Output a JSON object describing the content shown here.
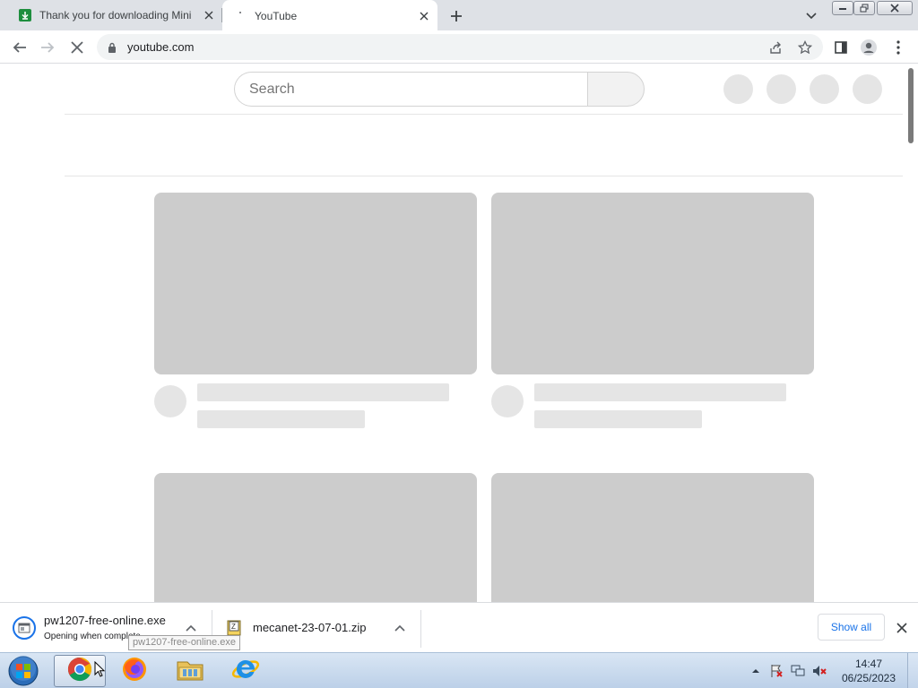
{
  "browser": {
    "tabs": [
      {
        "title": "Thank you for downloading Mini",
        "active": false
      },
      {
        "title": "YouTube",
        "active": true
      }
    ],
    "address": "youtube.com"
  },
  "youtube": {
    "search_placeholder": "Search"
  },
  "download_shelf": {
    "items": [
      {
        "filename": "pw1207-free-online.exe",
        "status": "Opening when complete"
      },
      {
        "filename": "mecanet-23-07-01.zip",
        "status": ""
      }
    ],
    "tooltip": "pw1207-free-online.exe",
    "show_all_label": "Show all"
  },
  "taskbar": {
    "time": "14:47",
    "date": "06/25/2023",
    "apps": [
      "chrome-icon",
      "firefox-icon",
      "file-explorer-icon",
      "internet-explorer-icon"
    ]
  },
  "colors": {
    "accent": "#1a73e8",
    "skeleton_dark": "#cccccc",
    "skeleton_light": "#e5e5e5",
    "tabstrip": "#dee1e6"
  }
}
